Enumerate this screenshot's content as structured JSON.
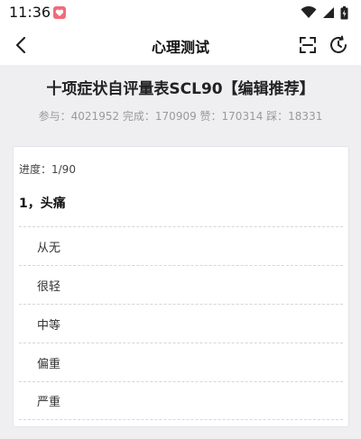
{
  "status": {
    "time": "11:36"
  },
  "header": {
    "title": "心理测试"
  },
  "test": {
    "title": "十项症状自评量表SCL90【编辑推荐】",
    "stats": "参与：4021952 完成：170909 赞：170314 踩：18331"
  },
  "card": {
    "progress": "进度：1/90",
    "question": "1，头痛",
    "options": [
      "从无",
      "很轻",
      "中等",
      "偏重",
      "严重"
    ]
  },
  "colors": {
    "background": "#efeff2",
    "card": "#ffffff",
    "notif_accent": "#f26b7a"
  },
  "icons": [
    "notification-icon",
    "wifi-icon",
    "signal-icon",
    "battery-icon",
    "back-icon",
    "scan-icon",
    "history-icon"
  ]
}
